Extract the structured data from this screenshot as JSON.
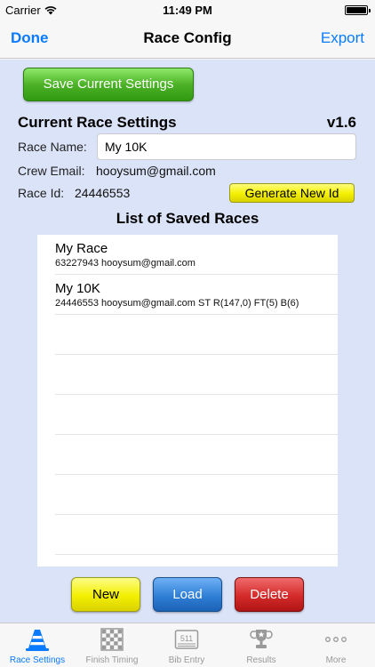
{
  "status_bar": {
    "carrier": "Carrier",
    "time": "11:49 PM"
  },
  "nav": {
    "left": "Done",
    "title": "Race Config",
    "right": "Export"
  },
  "buttons": {
    "save": "Save Current Settings",
    "generate": "Generate New Id",
    "new": "New",
    "load": "Load",
    "delete": "Delete"
  },
  "settings": {
    "title": "Current Race Settings",
    "version": "v1.6",
    "race_name_label": "Race Name:",
    "race_name_value": "My 10K",
    "crew_email_label": "Crew Email:",
    "crew_email_value": "hooysum@gmail.com",
    "race_id_label": "Race Id:",
    "race_id_value": "24446553"
  },
  "list": {
    "title": "List of Saved Races",
    "items": [
      {
        "name": "My Race",
        "detail": "63227943 hooysum@gmail.com"
      },
      {
        "name": "My 10K",
        "detail": "24446553 hooysum@gmail.com ST R(147,0) FT(5) B(6)"
      }
    ]
  },
  "tabs": [
    {
      "label": "Race Settings",
      "icon": "traffic-cone-icon",
      "active": true
    },
    {
      "label": "Finish Timing",
      "icon": "checkered-flag-icon",
      "active": false
    },
    {
      "label": "Bib Entry",
      "icon": "bib-number-icon",
      "bib_number": "511",
      "active": false
    },
    {
      "label": "Results",
      "icon": "trophy-icon",
      "active": false
    },
    {
      "label": "More",
      "icon": "more-dots-icon",
      "active": false
    }
  ],
  "colors": {
    "accent": "#0a7aff",
    "background": "#dbe3f8",
    "save": "#4db227",
    "generate": "#f4f000",
    "load": "#2f7fd6",
    "delete": "#d42a2a"
  }
}
